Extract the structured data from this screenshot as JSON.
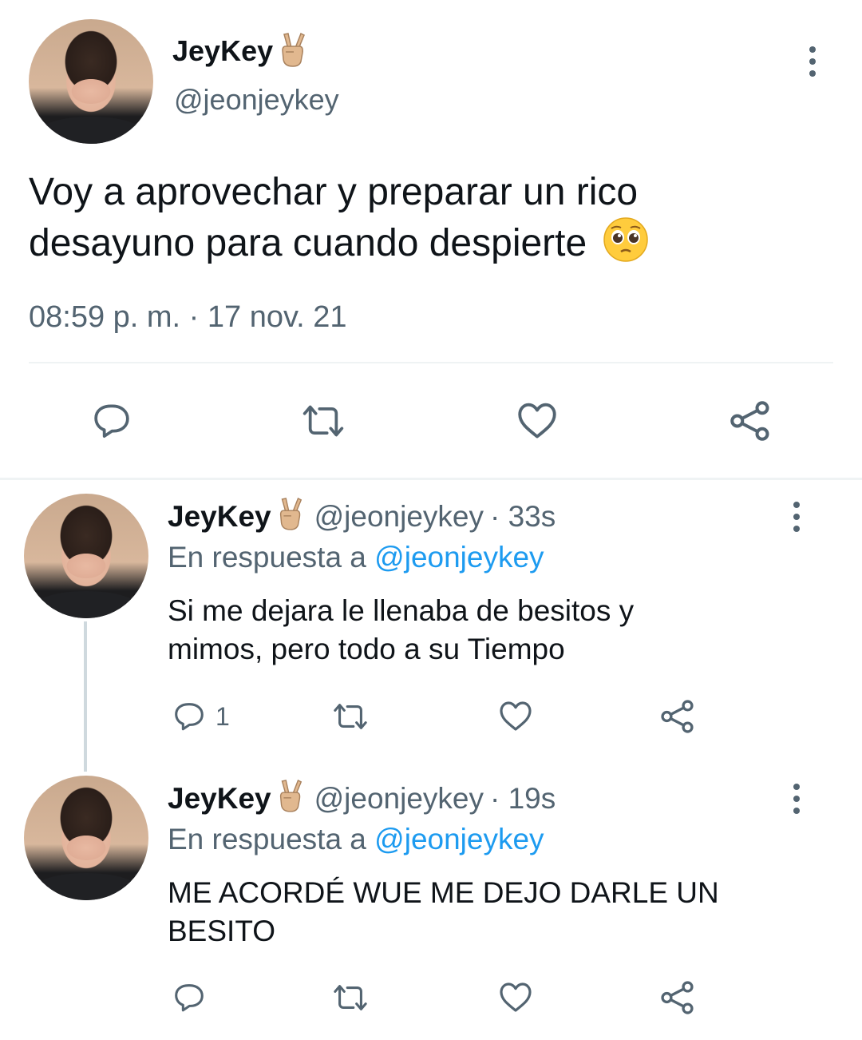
{
  "main_tweet": {
    "name": "JeyKey",
    "handle": "@jeonjeykey",
    "text_line1": "Voy a aprovechar y preparar un rico",
    "text_line2": "desayuno para cuando despierte",
    "timestamp": "08:59 p. m. · 17 nov. 21"
  },
  "replies": [
    {
      "name": "JeyKey",
      "handle": "@jeonjeykey",
      "time": "· 33s",
      "reply_prefix": "En respuesta a",
      "reply_to": "@jeonjeykey",
      "text_line1": "Si me dejara le llenaba de besitos y",
      "text_line2": "mimos, pero todo a su Tiempo",
      "reply_count": "1"
    },
    {
      "name": "JeyKey",
      "handle": "@jeonjeykey",
      "time": "· 19s",
      "reply_prefix": "En respuesta a",
      "reply_to": "@jeonjeykey",
      "text_line1": "ME ACORDÉ WUE ME DEJO DARLE UN",
      "text_line2": "BESITO",
      "reply_count": ""
    }
  ],
  "icons": [
    "victory-hand-emoji",
    "pleading-face-emoji",
    "more-options-icon",
    "reply-icon",
    "retweet-icon",
    "like-icon",
    "share-icon"
  ],
  "colors": {
    "text": "#0f1419",
    "secondary": "#536471",
    "link": "#1d9bf0",
    "divider": "#eff3f4"
  }
}
